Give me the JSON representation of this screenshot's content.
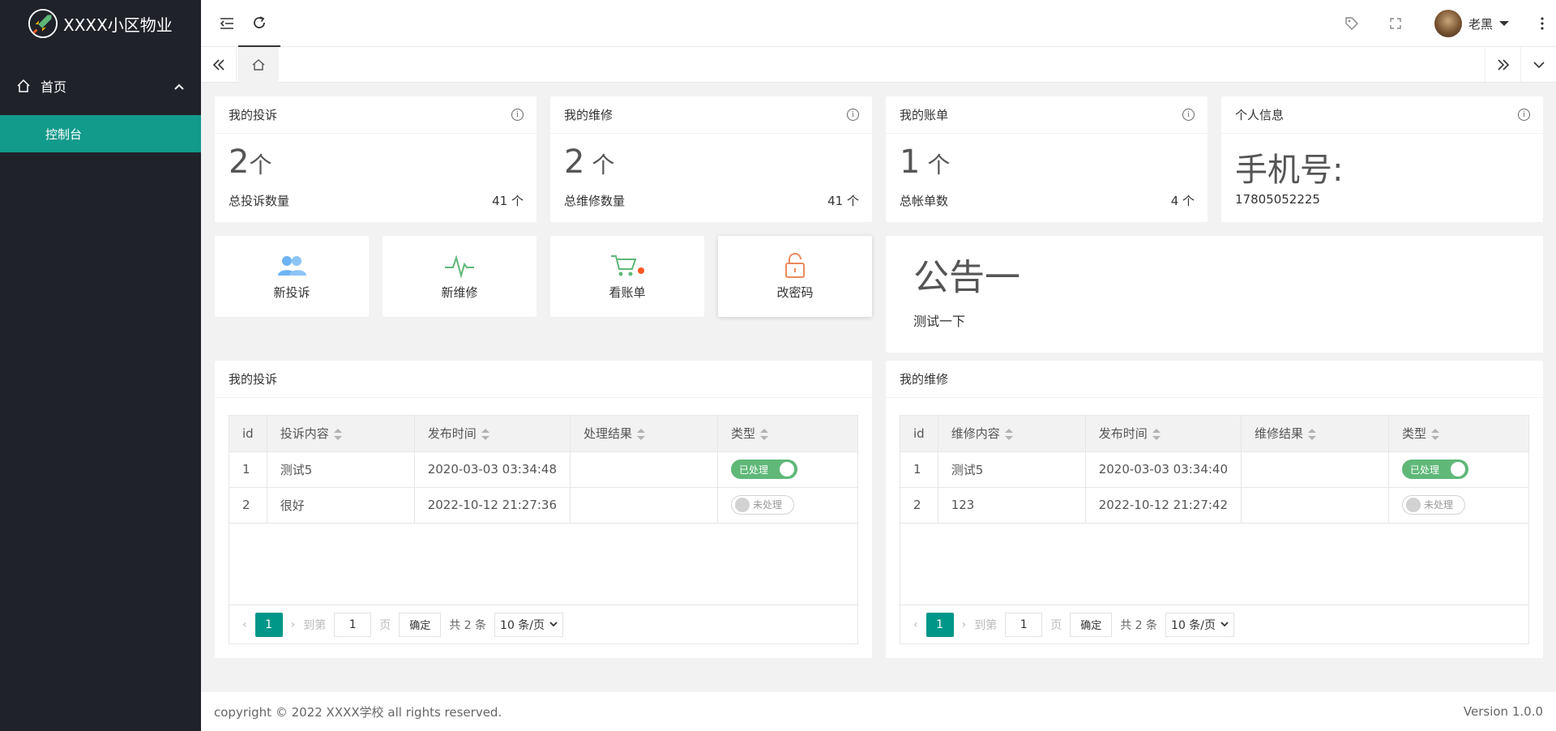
{
  "app": {
    "title": "XXXX小区物业"
  },
  "sidebar": {
    "home_label": "首页",
    "items": [
      {
        "label": "控制台"
      }
    ]
  },
  "header": {
    "user_name": "老黑",
    "icons": [
      "menu-fold-icon",
      "refresh-icon",
      "tag-icon",
      "fullscreen-icon",
      "more-icon"
    ]
  },
  "stats": [
    {
      "title": "我的投诉",
      "value": "2",
      "unit": "个",
      "footer_label": "总投诉数量",
      "footer_value": "41 个"
    },
    {
      "title": "我的维修",
      "value": "2",
      "unit": " 个",
      "footer_label": "总维修数量",
      "footer_value": "41 个"
    },
    {
      "title": "我的账单",
      "value": "1",
      "unit": " 个",
      "footer_label": "总帐单数",
      "footer_value": "4 个"
    },
    {
      "title": "个人信息",
      "value": "手机号:",
      "unit": "",
      "footer_label": "17805052225",
      "footer_value": ""
    }
  ],
  "quick": [
    {
      "label": "新投诉",
      "icon": "users-icon",
      "color": "#6db3f2"
    },
    {
      "label": "新维修",
      "icon": "pulse-icon",
      "color": "#5fb878"
    },
    {
      "label": "看账单",
      "icon": "cart-icon",
      "color": "#5fb878"
    },
    {
      "label": "改密码",
      "icon": "unlock-icon",
      "color": "#ea8a5e"
    }
  ],
  "notice": {
    "title": "公告一",
    "body": "测试一下"
  },
  "complaints": {
    "title": "我的投诉",
    "columns": [
      "id",
      "投诉内容",
      "发布时间",
      "处理结果",
      "类型"
    ],
    "rows": [
      {
        "id": "1",
        "content": "测试5",
        "time": "2020-03-03 03:34:48",
        "result": "",
        "status": "已处理",
        "done": true
      },
      {
        "id": "2",
        "content": "很好",
        "time": "2022-10-12 21:27:36",
        "result": "",
        "status": "未处理",
        "done": false
      }
    ]
  },
  "repairs": {
    "title": "我的维修",
    "columns": [
      "id",
      "维修内容",
      "发布时间",
      "维修结果",
      "类型"
    ],
    "rows": [
      {
        "id": "1",
        "content": "测试5",
        "time": "2020-03-03 03:34:40",
        "result": "",
        "status": "已处理",
        "done": true
      },
      {
        "id": "2",
        "content": "123",
        "time": "2022-10-12 21:27:42",
        "result": "",
        "status": "未处理",
        "done": false
      }
    ]
  },
  "pager": {
    "current": "1",
    "goto_label": "到第",
    "page_input": "1",
    "page_unit": "页",
    "confirm": "确定",
    "total": "共 2 条",
    "page_size": "10 条/页"
  },
  "footer": {
    "copyright": "copyright © 2022 XXXX学校 all rights reserved.",
    "version": "Version 1.0.0"
  },
  "colors": {
    "sidebar": "#20222a",
    "accent": "#009688",
    "active_menu": "#129a8a",
    "switch_on": "#5fb878"
  }
}
